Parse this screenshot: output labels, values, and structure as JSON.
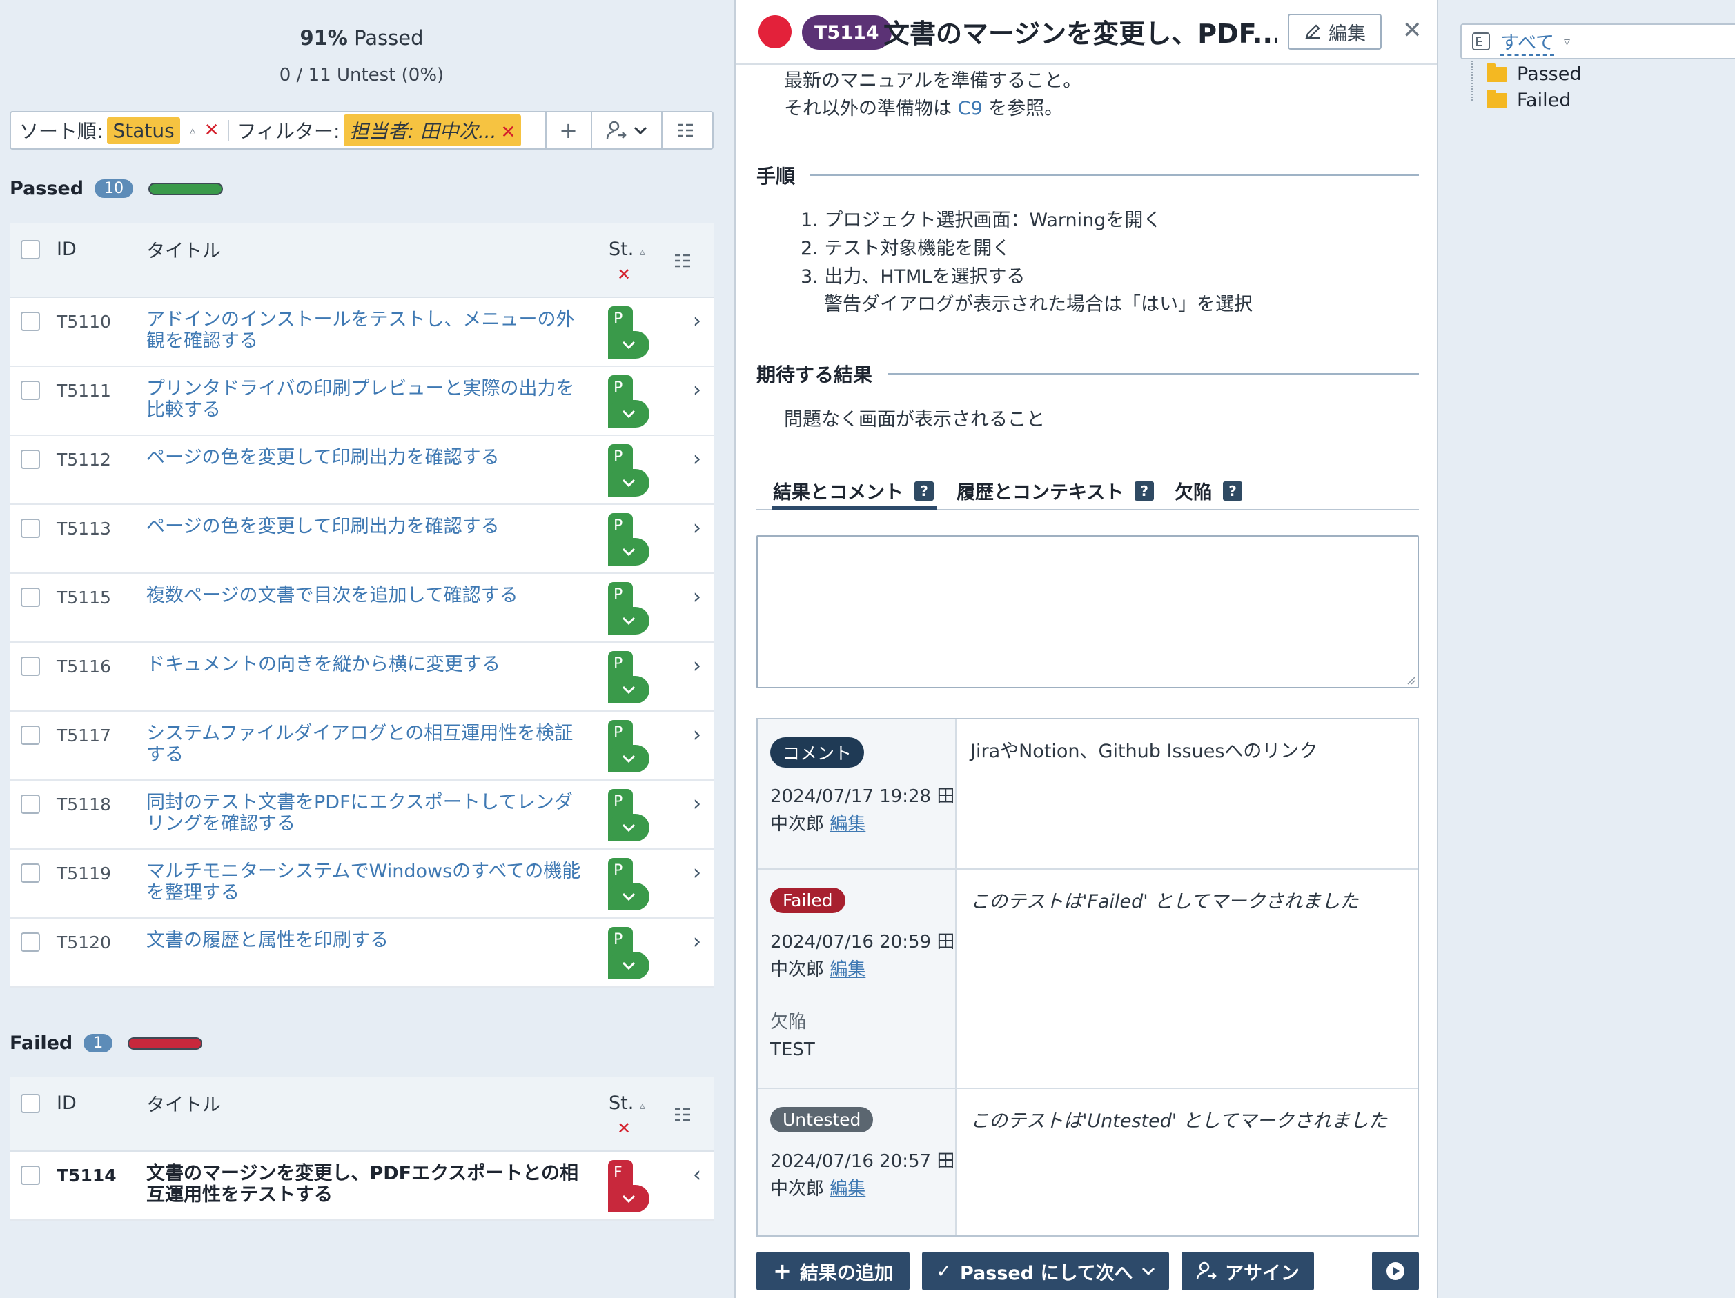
{
  "summary": {
    "passed_pct": "91%",
    "passed_label": "Passed",
    "untest": "0 / 11 Untest (0%)"
  },
  "toolbar": {
    "sort_label": "ソート順:",
    "sort_value": "Status",
    "filter_label": "フィルター:",
    "filter_value": "担当者: 田中次...",
    "add_icon": "plus-icon",
    "assign_icon": "assign-icon",
    "columns_icon": "columns-icon"
  },
  "groups": [
    {
      "name": "Passed",
      "count": "10",
      "color": "#3a9a4a",
      "header": {
        "id": "ID",
        "title": "タイトル",
        "status": "St."
      },
      "rows": [
        {
          "id": "T5110",
          "title": "アドインのインストールをテストし、メニューの外観を確認する",
          "status": "P"
        },
        {
          "id": "T5111",
          "title": "プリンタドライバの印刷プレビューと実際の出力を比較する",
          "status": "P"
        },
        {
          "id": "T5112",
          "title": "ページの色を変更して印刷出力を確認する",
          "status": "P"
        },
        {
          "id": "T5113",
          "title": "ページの色を変更して印刷出力を確認する",
          "status": "P"
        },
        {
          "id": "T5115",
          "title": "複数ページの文書で目次を追加して確認する",
          "status": "P"
        },
        {
          "id": "T5116",
          "title": "ドキュメントの向きを縦から横に変更する",
          "status": "P"
        },
        {
          "id": "T5117",
          "title": "システムファイルダイアログとの相互運用性を検証する",
          "status": "P"
        },
        {
          "id": "T5118",
          "title": "同封のテスト文書をPDFにエクスポートしてレンダリングを確認する",
          "status": "P"
        },
        {
          "id": "T5119",
          "title": "マルチモニターシステムでWindowsのすべての機能を整理する",
          "status": "P"
        },
        {
          "id": "T5120",
          "title": "文書の履歴と属性を印刷する",
          "status": "P"
        }
      ]
    },
    {
      "name": "Failed",
      "count": "1",
      "color": "#c8283c",
      "header": {
        "id": "ID",
        "title": "タイトル",
        "status": "St."
      },
      "rows": [
        {
          "id": "T5114",
          "title": "文書のマージンを変更し、PDFエクスポートとの相互運用性をテストする",
          "status": "F"
        }
      ]
    }
  ],
  "detail": {
    "id": "T5114",
    "title": "文書のマージンを変更し、PDF...",
    "edit_label": "編集",
    "close_icon": "close-icon",
    "pre1": "最新のマニュアルを準備すること。",
    "pre2a": "それ以外の準備物は",
    "pre2_link": "C9",
    "pre2b": "を参照。",
    "steps_title": "手順",
    "steps": [
      "1. プロジェクト選択画面：Warningを開く",
      "2. テスト対象機能を開く",
      "3. 出力、HTMLを選択する",
      "警告ダイアログが表示された場合は「はい」を選択"
    ],
    "expected_title": "期待する結果",
    "expected": "問題なく画面が表示されること",
    "tabs": [
      "結果とコメント",
      "履歴とコンテキスト",
      "欠陥"
    ],
    "history": [
      {
        "badge": "コメント",
        "badge_color": "#1f3a55",
        "date": "2024/07/17 19:28 田",
        "who": "中次郎",
        "edit": "編集",
        "text": "JiraやNotion、Github Issuesへのリンク"
      },
      {
        "badge": "Failed",
        "badge_color": "#a8202f",
        "date": "2024/07/16 20:59 田",
        "who": "中次郎",
        "edit": "編集",
        "defect_label": "欠陥",
        "defect_value": "TEST",
        "text": "このテストは'Failed' としてマークされました"
      },
      {
        "badge": "Untested",
        "badge_color": "#5b6670",
        "date": "2024/07/16 20:57 田",
        "who": "中次郎",
        "edit": "編集",
        "text": "このテストは'Untested' としてマークされました"
      }
    ],
    "actions": {
      "add_result": "結果の追加",
      "pass_next": "Passed にして次へ",
      "assign": "アサイン"
    }
  },
  "tree": {
    "root": "すべて",
    "items": [
      "Passed",
      "Failed"
    ]
  }
}
